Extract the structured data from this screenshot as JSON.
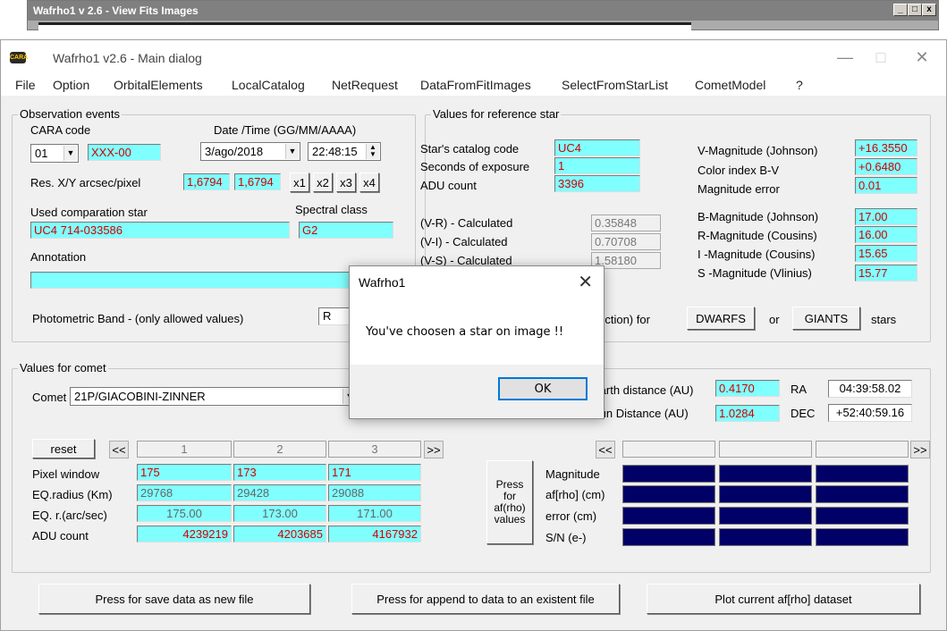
{
  "back_window": {
    "title": "Wafrho1 v 2.6 - View Fits Images",
    "controls": [
      "_",
      "□",
      "x"
    ]
  },
  "window": {
    "title": "Wafrho1 v2.6 - Main dialog",
    "icon_text": "CARA",
    "minimize": "—",
    "maximize": "□",
    "close": "✕"
  },
  "menu": [
    "File",
    "Option",
    "OrbitalElements",
    "LocalCatalog",
    "NetRequest",
    "DataFromFitImages",
    "SelectFromStarList",
    "CometModel",
    "?"
  ],
  "observation": {
    "legend": "Observation events",
    "cara_code_label": "CARA code",
    "date_time_label": "Date /Time  (GG/MM/AAAA)",
    "cara_select": "01",
    "cara_value": "XXX-00",
    "date_value": "3/ago/2018",
    "time_value": "22:48:15",
    "res_label": "Res. X/Y arcsec/pixel",
    "res_x": "1,6794",
    "res_y": "1,6794",
    "zoom_buttons": [
      "x1",
      "x2",
      "x3",
      "x4"
    ],
    "comp_star_label": "Used comparation star",
    "spectral_label": "Spectral class",
    "comp_star_value": "UC4 714-033586",
    "spectral_value": "G2",
    "annotation_label": "Annotation",
    "annotation_value": "",
    "band_label": "Photometric Band  - (only allowed values)",
    "band_value": "R"
  },
  "reference": {
    "legend": "Values for reference star",
    "catalog_label": "Star's catalog code",
    "catalog_value": "UC4",
    "exposure_label": "Seconds of exposure",
    "exposure_value": "1",
    "adu_label": "ADU count",
    "adu_value": "3396",
    "vr_label": "(V-R) - Calculated",
    "vr_value": "0.35848",
    "vi_label": "(V-I) -  Calculated",
    "vi_value": "0.70708",
    "vs_label": "(V-S) - Calculated",
    "vs_value": "1.58180",
    "vmag_label": "V-Magnitude (Johnson)",
    "vmag_value": "+16.3550",
    "bv_label": "Color index B-V",
    "bv_value": "+0.6480",
    "magerr_label": "Magnitude error",
    "magerr_value": "0.01",
    "bmag_label": "B-Magnitude (Johnson)",
    "bmag_value": "17.00",
    "rmag_label": "R-Magnitude (Cousins)",
    "rmag_value": "16.00",
    "imag_label": "I -Magnitude (Cousins)",
    "imag_value": "15.65",
    "smag_label": "S -Magnitude (Vlinius)",
    "smag_value": "15.77",
    "reduction_label": "(reduction) for",
    "dwarfs_button": "DWARFS",
    "or_label": "or",
    "giants_button": "GIANTS",
    "stars_label": "stars"
  },
  "comet": {
    "legend": "Values for comet",
    "comet_label": "Comet",
    "comet_value": "21P/GIACOBINI-ZINNER",
    "earth_label": "Earth distance (AU)",
    "earth_value": "0.4170",
    "sun_label": "Sun Distance (AU)",
    "sun_value": "1.0284",
    "ra_label": "RA",
    "ra_value": "04:39:58.02",
    "dec_label": "DEC",
    "dec_value": "+52:40:59.16",
    "reset_button": "reset",
    "prev_button": "<<",
    "next_button": ">>",
    "columns": [
      "1",
      "2",
      "3"
    ],
    "pixel_window_label": "Pixel window",
    "pixel_window": [
      "175",
      "173",
      "171"
    ],
    "eq_radius_label": "EQ.radius (Km)",
    "eq_radius": [
      "29768",
      "29428",
      "29088"
    ],
    "eq_r_label": "EQ. r.(arc/sec)",
    "eq_r": [
      "175.00",
      "173.00",
      "171.00"
    ],
    "adu_label": "ADU count",
    "adu": [
      "4239219",
      "4203685",
      "4167932"
    ],
    "press_button": "Press for af(rho) values",
    "magnitude_label": "Magnitude",
    "afrho_label": "af[rho] (cm)",
    "error_label": "error (cm)",
    "sn_label": "S/N (e-)"
  },
  "footer": {
    "save_button": "Press for save data as new file",
    "append_button": "Press for append to  data to an existent file",
    "plot_button": "Plot current af[rho] dataset"
  },
  "dialog": {
    "title": "Wafrho1",
    "close": "✕",
    "message": "You've choosen a star on image !!",
    "ok_button": "OK"
  },
  "colors": {
    "input_bg": "#80ffff",
    "input_text": "#d00000",
    "navy_field": "#000066"
  }
}
